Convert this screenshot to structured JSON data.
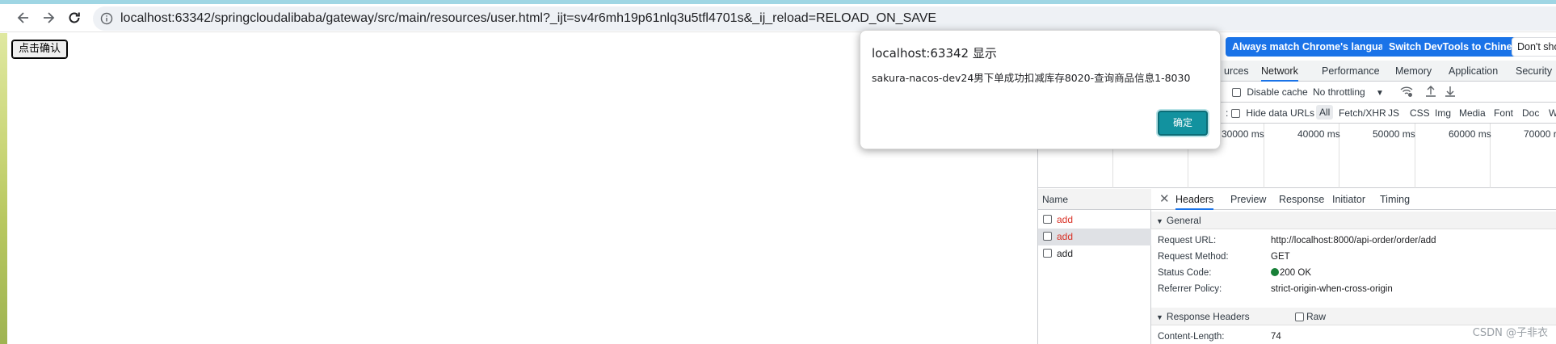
{
  "browser": {
    "url": "localhost:63342/springcloudalibaba/gateway/src/main/resources/user.html?_ijt=sv4r6mh19p61nlq3u5tfl4701s&_ij_reload=RELOAD_ON_SAVE",
    "back_icon": "arrow-left-icon",
    "forward_icon": "arrow-right-icon",
    "reload_icon": "reload-icon",
    "info_icon": "info-icon"
  },
  "page": {
    "confirm_button_label": "点击确认"
  },
  "dialog": {
    "title": "localhost:63342 显示",
    "message": "sakura-nacos-dev24男下单成功扣减库存8020-查询商品信息1-8030",
    "ok_label": "确定"
  },
  "devtools": {
    "lang_buttons": {
      "match_language": "Always match Chrome's language",
      "switch_chinese": "Switch DevTools to Chinese",
      "dont_show": "Don't sho"
    },
    "tabs": [
      "urces",
      "Network",
      "Performance",
      "Memory",
      "Application",
      "Security"
    ],
    "active_tab": "Network",
    "network_toolbar": {
      "disable_cache": "Disable cache",
      "throttling": "No throttling"
    },
    "filters": {
      "partial": ":",
      "hide_data_urls": "Hide data URLs",
      "types": [
        "All",
        "Fetch/XHR",
        "JS",
        "CSS",
        "Img",
        "Media",
        "Font",
        "Doc",
        "W"
      ]
    },
    "timeline_labels": [
      "30000 ms",
      "40000 ms",
      "50000 ms",
      "60000 ms",
      "70000 r"
    ],
    "name_header": "Name",
    "requests": [
      {
        "name": "add",
        "color": "#d93025"
      },
      {
        "name": "add",
        "color": "#d93025"
      },
      {
        "name": "add",
        "color": "#202124"
      }
    ],
    "detail_tabs": [
      "Headers",
      "Preview",
      "Response",
      "Initiator",
      "Timing"
    ],
    "active_detail_tab": "Headers",
    "general": {
      "title": "General",
      "rows": [
        {
          "key": "Request URL:",
          "value": "http://localhost:8000/api-order/order/add"
        },
        {
          "key": "Request Method:",
          "value": "GET"
        },
        {
          "key": "Status Code:",
          "value": "200 OK"
        },
        {
          "key": "Referrer Policy:",
          "value": "strict-origin-when-cross-origin"
        }
      ]
    },
    "response_headers": {
      "title": "Response Headers",
      "raw_label": "Raw",
      "rows": [
        {
          "key": "Content-Length:",
          "value": "74"
        }
      ]
    },
    "status_color": "#188038"
  },
  "watermark": "CSDN @子非衣"
}
